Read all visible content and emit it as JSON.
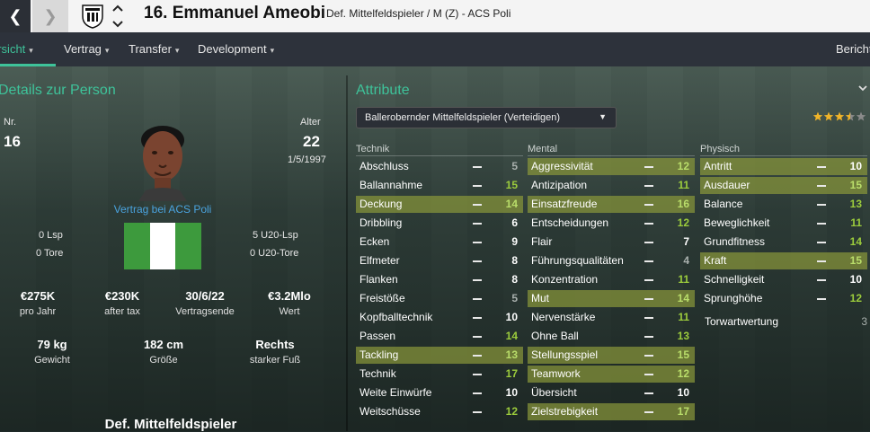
{
  "header": {
    "player_name": "16. Emmanuel Ameobi",
    "player_subtitle": "Def. Mittelfeldspieler / M (Z) - ACS Poli",
    "back_glyph": "❮",
    "forward_glyph": "❯"
  },
  "tabs": [
    {
      "label": "ersicht",
      "active": true
    },
    {
      "label": "Vertrag"
    },
    {
      "label": "Transfer"
    },
    {
      "label": "Development"
    },
    {
      "label": "Bericht"
    }
  ],
  "details": {
    "title": "Details zur Person",
    "nr_label": "Nr.",
    "nr_value": "16",
    "age_label": "Alter",
    "age_value": "22",
    "birthdate": "1/5/1997",
    "contract_label": "Vertrag bei ACS Poli",
    "left_stats": [
      "0 Lsp",
      "0 Tore"
    ],
    "right_stats": [
      "5 U20-Lsp",
      "0 U20-Tore"
    ],
    "money": [
      {
        "value": "€275K",
        "label": "pro Jahr"
      },
      {
        "value": "€230K",
        "label": "after tax"
      },
      {
        "value": "30/6/22",
        "label": "Vertragsende"
      },
      {
        "value": "€3.2Mlo",
        "label": "Wert"
      }
    ],
    "physical": [
      {
        "value": "79 kg",
        "label": "Gewicht"
      },
      {
        "value": "182 cm",
        "label": "Größe"
      },
      {
        "value": "Rechts",
        "label": "starker Fuß"
      }
    ],
    "position": "Def. Mittelfeldspieler",
    "flag_colors": [
      "#3d9a3d",
      "#ffffff",
      "#3d9a3d"
    ]
  },
  "attributes": {
    "title": "Attribute",
    "role_selected": "Ballerobernder Mittelfeldspieler (Verteidigen)",
    "stars": "3.5 of 5",
    "columns": [
      {
        "heading": "Technik",
        "rows": [
          {
            "name": "Abschluss",
            "value": "5",
            "color": "grey",
            "hl": false
          },
          {
            "name": "Ballannahme",
            "value": "15",
            "color": "green",
            "hl": false
          },
          {
            "name": "Deckung",
            "value": "14",
            "color": "lgreen",
            "hl": true
          },
          {
            "name": "Dribbling",
            "value": "6",
            "color": "white",
            "hl": false
          },
          {
            "name": "Ecken",
            "value": "9",
            "color": "white",
            "hl": false
          },
          {
            "name": "Elfmeter",
            "value": "8",
            "color": "white",
            "hl": false
          },
          {
            "name": "Flanken",
            "value": "8",
            "color": "white",
            "hl": false
          },
          {
            "name": "Freistöße",
            "value": "5",
            "color": "grey",
            "hl": false
          },
          {
            "name": "Kopfballtechnik",
            "value": "10",
            "color": "white",
            "hl": false
          },
          {
            "name": "Passen",
            "value": "14",
            "color": "green",
            "hl": false
          },
          {
            "name": "Tackling",
            "value": "13",
            "color": "lgreen",
            "hl": true
          },
          {
            "name": "Technik",
            "value": "17",
            "color": "green",
            "hl": false
          },
          {
            "name": "Weite Einwürfe",
            "value": "10",
            "color": "white",
            "hl": false
          },
          {
            "name": "Weitschüsse",
            "value": "12",
            "color": "green",
            "hl": false
          }
        ]
      },
      {
        "heading": "Mental",
        "rows": [
          {
            "name": "Aggressivität",
            "value": "12",
            "color": "lgreen",
            "hl": true
          },
          {
            "name": "Antizipation",
            "value": "11",
            "color": "green",
            "hl": false
          },
          {
            "name": "Einsatzfreude",
            "value": "16",
            "color": "lgreen",
            "hl": true
          },
          {
            "name": "Entscheidungen",
            "value": "12",
            "color": "green",
            "hl": false
          },
          {
            "name": "Flair",
            "value": "7",
            "color": "white",
            "hl": false
          },
          {
            "name": "Führungsqualitäten",
            "value": "4",
            "color": "grey",
            "hl": false
          },
          {
            "name": "Konzentration",
            "value": "11",
            "color": "green",
            "hl": false
          },
          {
            "name": "Mut",
            "value": "14",
            "color": "lgreen",
            "hl": true
          },
          {
            "name": "Nervenstärke",
            "value": "11",
            "color": "green",
            "hl": false
          },
          {
            "name": "Ohne Ball",
            "value": "13",
            "color": "green",
            "hl": false
          },
          {
            "name": "Stellungsspiel",
            "value": "15",
            "color": "lgreen",
            "hl": true
          },
          {
            "name": "Teamwork",
            "value": "12",
            "color": "lgreen",
            "hl": true
          },
          {
            "name": "Übersicht",
            "value": "10",
            "color": "white",
            "hl": false
          },
          {
            "name": "Zielstrebigkeit",
            "value": "17",
            "color": "lgreen",
            "hl": true
          }
        ]
      },
      {
        "heading": "Physisch",
        "rows": [
          {
            "name": "Antritt",
            "value": "10",
            "color": "white",
            "hl": true
          },
          {
            "name": "Ausdauer",
            "value": "15",
            "color": "lgreen",
            "hl": true
          },
          {
            "name": "Balance",
            "value": "13",
            "color": "green",
            "hl": false
          },
          {
            "name": "Beweglichkeit",
            "value": "11",
            "color": "green",
            "hl": false
          },
          {
            "name": "Grundfitness",
            "value": "14",
            "color": "green",
            "hl": false
          },
          {
            "name": "Kraft",
            "value": "15",
            "color": "lgreen",
            "hl": true
          },
          {
            "name": "Schnelligkeit",
            "value": "10",
            "color": "white",
            "hl": false
          },
          {
            "name": "Sprunghöhe",
            "value": "12",
            "color": "green",
            "hl": false
          }
        ]
      }
    ],
    "goalkeeper_label": "Torwartwertung",
    "goalkeeper_value": "3"
  }
}
